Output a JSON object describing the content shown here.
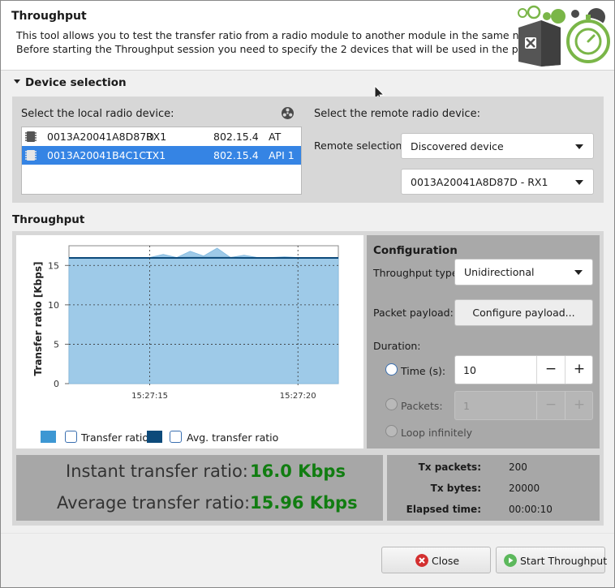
{
  "header": {
    "title": "Throughput",
    "description_line1": "This tool allows you to test the transfer ratio from a radio module to another module in the same network.",
    "description_line2": "Before starting the Throughput session you need to specify the 2 devices that will be used in the process."
  },
  "device_selection": {
    "title": "Device selection",
    "local_label": "Select the local radio device:",
    "remote_label": "Select the remote radio device:",
    "devices": [
      {
        "address": "0013A20041A8D87D",
        "name": "RX1",
        "protocol": "802.15.4",
        "mode": "AT",
        "selected": false
      },
      {
        "address": "0013A20041B4C1C1",
        "name": "TX1",
        "protocol": "802.15.4",
        "mode": "API 1",
        "selected": true
      }
    ],
    "remote_selection_label": "Remote selection:",
    "remote_selection_value": "Discovered device",
    "remote_device_value": "0013A20041A8D87D - RX1"
  },
  "throughput": {
    "title": "Throughput",
    "configuration_title": "Configuration",
    "throughput_type_label": "Throughput type:",
    "throughput_type_value": "Unidirectional",
    "packet_payload_label": "Packet payload:",
    "configure_payload_button": "Configure payload...",
    "duration_label": "Duration:",
    "time_label": "Time (s):",
    "time_value": "10",
    "packets_label": "Packets:",
    "packets_value": "1",
    "loop_label": "Loop infinitely",
    "duration_mode": "time",
    "minus_symbol": "−",
    "plus_symbol": "+"
  },
  "stats": {
    "instant_label": "Instant transfer ratio:",
    "instant_value": "16.0 Kbps",
    "average_label": "Average transfer ratio:",
    "average_value": "15.96 Kbps",
    "tx_packets_label": "Tx packets:",
    "tx_packets_value": "200",
    "tx_bytes_label": "Tx bytes:",
    "tx_bytes_value": "20000",
    "elapsed_label": "Elapsed time:",
    "elapsed_value": "00:00:10"
  },
  "legend": {
    "transfer_ratio": "Transfer ratio",
    "avg_transfer_ratio": "Avg. transfer ratio",
    "transfer_ratio_checked": false,
    "avg_transfer_ratio_checked": false
  },
  "chart_data": {
    "type": "area",
    "ylabel": "Transfer ratio [Kbps]",
    "xlabel": "",
    "ylim": [
      0,
      17.5
    ],
    "yticks": [
      0,
      5,
      10,
      15
    ],
    "xtick_labels": [
      "15:27:15",
      "15:27:20"
    ],
    "x": [
      0,
      0.5,
      1,
      1.5,
      2,
      2.5,
      3,
      3.5,
      4,
      4.5,
      5,
      5.5,
      6,
      6.5,
      7,
      7.5,
      8,
      8.5,
      9,
      9.5,
      10
    ],
    "series": [
      {
        "name": "Transfer ratio",
        "values": [
          16.0,
          16.0,
          16.0,
          16.0,
          16.0,
          16.0,
          16.0,
          16.4,
          16.0,
          16.8,
          16.2,
          17.2,
          16.0,
          16.3,
          16.0,
          16.0,
          16.1,
          16.0,
          16.0,
          16.0,
          16.0
        ],
        "color": "#9ecae8"
      },
      {
        "name": "Avg. transfer ratio",
        "values": [
          15.95,
          15.95,
          15.95,
          15.96,
          15.96,
          15.96,
          15.96,
          15.96,
          15.96,
          15.97,
          15.97,
          15.97,
          15.97,
          15.96,
          15.96,
          15.96,
          15.96,
          15.96,
          15.96,
          15.96,
          15.96
        ],
        "color": "#0c4a7a"
      }
    ],
    "vertical_markers": [
      3,
      8.5
    ],
    "grid": true
  },
  "colors": {
    "selection": "#3584e4",
    "value_green": "#117d11",
    "area_fill": "#9ecae8",
    "avg_line": "#0c4a7a",
    "legend_swatch_1": "#3d97d3",
    "legend_swatch_2": "#0c4a7a"
  },
  "footer": {
    "close_button": "Close",
    "start_button": "Start Throughput"
  },
  "icons": {
    "header_logo": "toolbox-stopwatch-icon",
    "module": "radio-module-icon",
    "discover": "discover-devices-icon",
    "close": "close-icon",
    "start": "play-icon"
  }
}
